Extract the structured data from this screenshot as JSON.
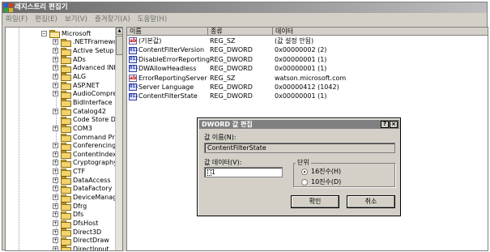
{
  "window": {
    "title": "레지스트리 편집기",
    "menu": [
      "파일(F)",
      "편집(E)",
      "보기(V)",
      "즐겨찾기(A)",
      "도움말(H)"
    ]
  },
  "tree": {
    "parent": {
      "expander": "−",
      "label": "Microsoft"
    },
    "items": [
      {
        "expander": "+",
        "label": ".NETFramewo"
      },
      {
        "expander": "+",
        "label": "Active Setup"
      },
      {
        "expander": "+",
        "label": "ADs"
      },
      {
        "expander": "+",
        "label": "Advanced INF"
      },
      {
        "expander": "+",
        "label": "ALG"
      },
      {
        "expander": "+",
        "label": "ASP.NET"
      },
      {
        "expander": "+",
        "label": "AudioCompre"
      },
      {
        "expander": "",
        "label": "BidInterface"
      },
      {
        "expander": "+",
        "label": "Catalog42"
      },
      {
        "expander": "",
        "label": "Code Store Da"
      },
      {
        "expander": "+",
        "label": "COM3"
      },
      {
        "expander": "",
        "label": "Command Pro"
      },
      {
        "expander": "+",
        "label": "Conferencing"
      },
      {
        "expander": "+",
        "label": "ContentIndex("
      },
      {
        "expander": "+",
        "label": "Cryptography"
      },
      {
        "expander": "+",
        "label": "CTF"
      },
      {
        "expander": "+",
        "label": "DataAccess"
      },
      {
        "expander": "+",
        "label": "DataFactory"
      },
      {
        "expander": "+",
        "label": "DeviceManag"
      },
      {
        "expander": "+",
        "label": "Dfrg"
      },
      {
        "expander": "+",
        "label": "Dfs"
      },
      {
        "expander": "+",
        "label": "DfsHost"
      },
      {
        "expander": "+",
        "label": "Direct3D"
      },
      {
        "expander": "+",
        "label": "DirectDraw"
      },
      {
        "expander": "+",
        "label": "DirectInput"
      }
    ],
    "scroll_up_arrow": "▲"
  },
  "list": {
    "columns": [
      "이름",
      "종류",
      "데이터"
    ],
    "rows": [
      {
        "icon": "string-value-icon",
        "glyph": "ab",
        "name": "(기본값)",
        "type": "REG_SZ",
        "data": "(값 설정 안됨)"
      },
      {
        "icon": "binary-value-icon",
        "glyph": "011",
        "name": "ContentFilterVersion",
        "type": "REG_DWORD",
        "data": "0x00000002 (2)"
      },
      {
        "icon": "binary-value-icon",
        "glyph": "011",
        "name": "DisableErrorReporting",
        "type": "REG_DWORD",
        "data": "0x00000001 (1)"
      },
      {
        "icon": "binary-value-icon",
        "glyph": "011",
        "name": "DWAllowHeadless",
        "type": "REG_DWORD",
        "data": "0x00000001 (1)"
      },
      {
        "icon": "string-value-icon",
        "glyph": "ab",
        "name": "ErrorReportingServer",
        "type": "REG_SZ",
        "data": "watson.microsoft.com"
      },
      {
        "icon": "binary-value-icon",
        "glyph": "011",
        "name": "Server Language",
        "type": "REG_DWORD",
        "data": "0x00000412 (1042)"
      },
      {
        "icon": "binary-value-icon",
        "glyph": "011",
        "name": "ContentFilterState",
        "type": "REG_DWORD",
        "data": "0x00000001 (1)"
      }
    ]
  },
  "dialog": {
    "title": "DWORD 값 편집",
    "help_glyph": "?",
    "close_glyph": "×",
    "value_name_label": "값 이름(N):",
    "value_name": "ContentFilterState",
    "value_data_label": "값 데이터(V):",
    "value_data": "1",
    "base_label": "단위",
    "base_options": [
      {
        "label": "16진수(H)",
        "selected": true
      },
      {
        "label": "10진수(D)",
        "selected": false
      }
    ],
    "ok_label": "확인",
    "cancel_label": "취소"
  }
}
